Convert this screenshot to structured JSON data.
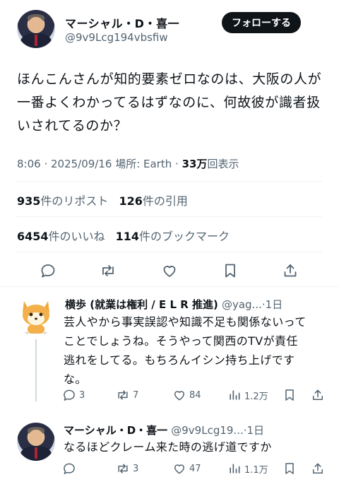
{
  "tweet": {
    "author_name": "マーシャル・D・喜一",
    "author_handle": "@9v9Lcg194vbsfiw",
    "follow_label": "フォローする",
    "text_line1": "ほんこんさんが知的要素ゼロなのは、大阪の人が",
    "text_line2": "一番よくわかってるはずなのに、何故彼が識者扱",
    "text_line3": "いされてるのか？",
    "time": "8:06 · 2025/09/16 場所: Earth · ",
    "views_count": "33万",
    "views_label": "回表示",
    "reposts_count": "935",
    "reposts_label": "件のリポスト",
    "quotes_count": "126",
    "quotes_label": "件の引用",
    "likes_count": "6454",
    "likes_label": "件のいいね",
    "bookmarks_count": "114",
    "bookmarks_label": "件のブックマーク"
  },
  "replies": [
    {
      "author_name": "横歩 (就業は権利 / E L R 推進)",
      "author_handle": "@yag...",
      "time": "·1日",
      "line1": "芸人やから事実誤認や知識不足も関係ないって",
      "line2": "ことでしょうね。そうやって関西のTVが責任",
      "line3": "逃れをしてる。もちろんイシン持ち上げです",
      "line4": "な。",
      "reply_count": "3",
      "repost_count": "7",
      "like_count": "84",
      "view_count": "1.2万"
    },
    {
      "author_name": "マーシャル・D・喜一",
      "author_handle": "@9v9Lcg19...",
      "time": "·1日",
      "line1": "なるほどクレーム来た時の逃げ道ですか",
      "reply_count": "",
      "repost_count": "3",
      "like_count": "47",
      "view_count": "1.1万"
    }
  ],
  "colors": {
    "text": "#0f1419",
    "secondary": "#536471",
    "divider": "#eff3f4",
    "follow_bg": "#0f1419"
  }
}
